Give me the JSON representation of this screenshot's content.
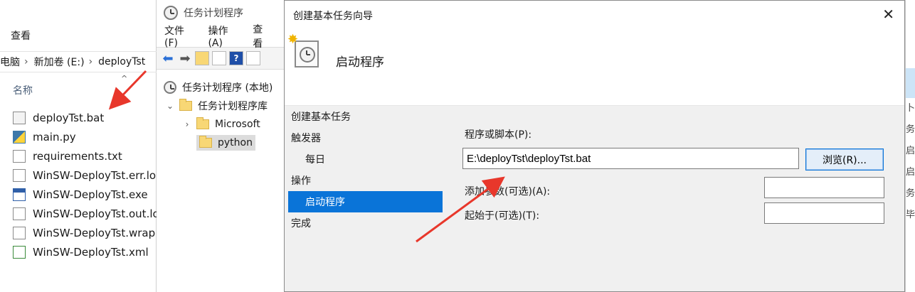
{
  "explorer": {
    "ribbon_view": "查看",
    "address": [
      "电脑",
      "新加卷 (E:)",
      "deployTst"
    ],
    "column_header": "名称",
    "files": [
      {
        "name": "deployTst.bat",
        "icon": "bat-file-icon"
      },
      {
        "name": "main.py",
        "icon": "python-file-icon"
      },
      {
        "name": "requirements.txt",
        "icon": "text-file-icon"
      },
      {
        "name": "WinSW-DeployTst.err.lo",
        "icon": "text-file-icon"
      },
      {
        "name": "WinSW-DeployTst.exe",
        "icon": "exe-file-icon"
      },
      {
        "name": "WinSW-DeployTst.out.lo",
        "icon": "text-file-icon"
      },
      {
        "name": "WinSW-DeployTst.wrap",
        "icon": "text-file-icon"
      },
      {
        "name": "WinSW-DeployTst.xml",
        "icon": "xml-file-icon"
      }
    ]
  },
  "scheduler": {
    "title": "任务计划程序",
    "menu": [
      "文件(F)",
      "操作(A)",
      "查看"
    ],
    "tree": {
      "root": "任务计划程序 (本地)",
      "library": "任务计划程序库",
      "folders": [
        "Microsoft",
        "python"
      ]
    }
  },
  "wizard": {
    "title": "创建基本任务向导",
    "heading": "启动程序",
    "steps": [
      "创建基本任务",
      "触发器",
      "每日",
      "操作",
      "启动程序",
      "完成"
    ],
    "program_label": "程序或脚本(P):",
    "program_value": "E:\\deployTst\\deployTst.bat",
    "browse_label": "浏览(R)...",
    "args_label": "添加参数(可选)(A):",
    "args_value": "",
    "start_in_label": "起始于(可选)(T):",
    "start_in_value": ""
  },
  "background_right": [
    "卜任",
    "务...",
    "启正",
    "启任",
    "务...",
    "毕关"
  ],
  "colors": {
    "accent": "#0a74d8",
    "annotation_arrow": "#e8372b"
  }
}
